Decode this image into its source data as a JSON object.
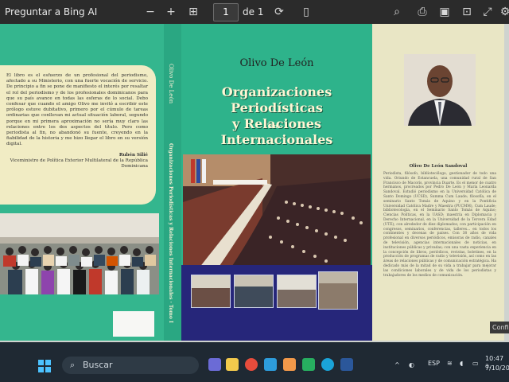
{
  "toolbar": {
    "ask_bing": "Preguntar a Bing AI",
    "page_current": "1",
    "page_total": "de 1"
  },
  "book": {
    "back_quote": "El libro es el esfuerzo de un profesional del periodismo, afectado a su Ministerio, con una fuerte vocación de servicio. De principio a fin se pone de manifiesto el interés por resaltar el rol del periodismo y de los profesionales dominicanos para que su país avance en todas las esferas de lo social. Debo confesar que cuando el amigo Olivo me invitó a escribir este prólogo estuve dubitativo, primero por el cúmulo de tareas ordinarias que conllevan mi actual situación laboral, segundo porque en mi primera aproximación no sería muy claro las relaciones entre los dos aspectos del título. Pero como periodista al fin, no abandonó su fuente, creyendo en la fiabilidad de la historia y me hizo llegar el libro en su versión digital.",
    "back_sign_name": "Rubén Silié",
    "back_sign_role": "Viceministro de Política Exterior Multilateral de la República Dominicana",
    "spine_author": "Olivo De León",
    "spine_title": "Organizaciones Periodísticas y Relaciones Internacionales · Tomo I",
    "author": "Olivo De León",
    "title_line1": "Organizaciones Periodísticas",
    "title_line2": "y Relaciones Internacionales",
    "tomo": "Tomo I",
    "bio_title": "Olivo De León Sandoval",
    "bio_text": "Periodista, filósofo, bibliotecólogo, gestionador de todo una vida. Oriundo de Estancuela, una comunidad rural de San Francisco de Macorís, provincia Duarte. Es el menor de cuatro hermanos, procreados por Pedro De León y María Leonarda Sandoval. Estudió periodismo en la Universidad Católica de Santo Domingo (UCSD), Summa Cum Laude; filosofía, en el seminario Santo Tomás de Aquino y en la Pontificia Universidad Católica Madre y Maestra (PUCMM), Cum Laude; bibliotecología, en el Seminario Santo Tomás de Aquino; Ciencias Políticas, en la UASD; maestría en Diplomacia y Derecho Internacional, en la Universidad de la Tercera Edad (UTE); con alrededor de diez diplomados; con participación en congresos, seminarios, conferencias, talleres... en todos los continentes y decenas de países. Con 38 años de vida profesional en diversos periódicos, emisoras de radio, canales de televisión, agencias internacionales de noticias, en instituciones públicas y privadas; con una vasta experiencia en la concepción de libros, periódicos, revistas, boletines, en la producción de programas de radio y televisión, así como en las áreas de relaciones públicas y de comunicación estratégica. Ha dedicado más de la mitad de su vida a trabajar para mejorar las condiciones laborales y de vida de los periodistas y trabajadores de los medios de comunicación."
  },
  "taskbar": {
    "search_placeholder": "Buscar",
    "language": "ESP",
    "time": "10:47 a.",
    "date": "7/10/20",
    "tooltip": "Confi"
  },
  "colors": {
    "cover_green": "#2eb38b",
    "quote_cream": "#f1ecc4",
    "thumb_band": "#26267a"
  },
  "icons": [
    "zoom-out-icon",
    "zoom-in-icon",
    "fit-page-icon",
    "rotate-icon",
    "two-page-icon",
    "search-icon",
    "print-icon",
    "save-icon",
    "more-icon",
    "fullscreen-icon",
    "windows-start-icon",
    "edge-icon",
    "chrome-icon",
    "word-icon"
  ]
}
